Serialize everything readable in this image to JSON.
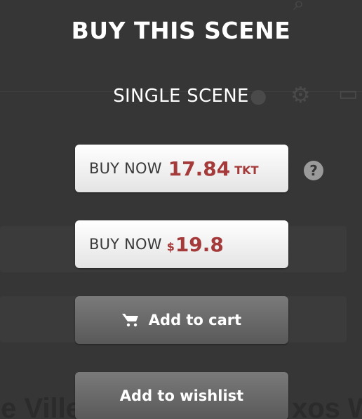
{
  "modal": {
    "title": "BUY THIS SCENE",
    "subtitle": "SINGLE SCENE",
    "buy_tokens": {
      "label": "BUY NOW",
      "price": "17.84",
      "unit": "TKT"
    },
    "buy_dollars": {
      "label": "BUY NOW",
      "currency": "$",
      "price": "19.8"
    },
    "add_to_cart_label": "Add to cart",
    "add_to_wishlist_label": "Add to wishlist",
    "help_icon": "question-circle-icon",
    "help_glyph": "?",
    "cart_icon": "shopping-cart-icon"
  },
  "background": {
    "bottom_text_left": "le Ville",
    "bottom_text_right": "xos W"
  },
  "colors": {
    "price_red": "#a53a3a",
    "overlay_bg": "#363636",
    "dark_button": "#6a6a6a"
  }
}
